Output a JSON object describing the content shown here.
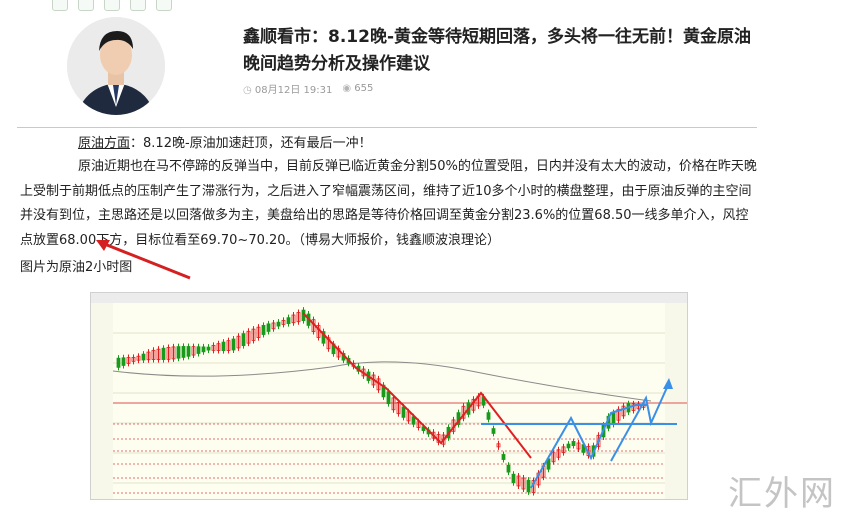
{
  "article": {
    "title": "鑫顺看市：8.12晚-黄金等待短期回落，多头将一往无前！黄金原油晚间趋势分析及操作建议",
    "date": "08月12日 19:31",
    "views": "655",
    "date_icon": "clock-icon",
    "views_icon": "eye-icon"
  },
  "body": {
    "heading_label": "原油方面",
    "heading_rest": "：8.12晚-原油加速赶顶，还有最后一冲！",
    "paragraph": "原油近期也在马不停蹄的反弹当中，目前反弹已临近黄金分割50%的位置受阻，日内并没有太大的波动，价格在昨天晚上受制于前期低点的压制产生了滞涨行为，之后进入了窄幅震荡区间，维持了近10多个小时的横盘整理，由于原油反弹的主空间并没有到位，主思路还是以回落做多为主，美盘给出的思路是等待价格回调至黄金分割23.6%的位置68.50一线多单介入，风控点放置68.00下方，目标位看至69.70~70.20。（博易大师报价，钱鑫顺波浪理论）",
    "caption": "图片为原油2小时图"
  },
  "watermark": "汇外网",
  "colors": {
    "annotation_red": "#d42020",
    "annotation_blue": "#3a8fe6",
    "candle_up": "#e02020",
    "candle_down": "#1a9a1a"
  }
}
